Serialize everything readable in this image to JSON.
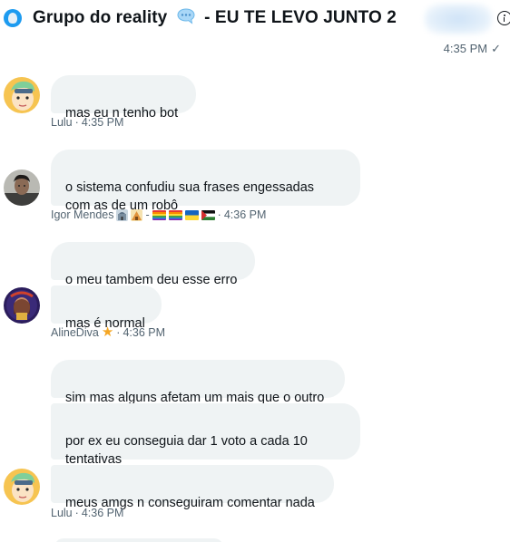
{
  "header": {
    "title_prefix": "Grupo do reality",
    "title_suffix": "- EU TE LEVO JUNTO 2",
    "group_icon": "water-drop-avatar",
    "speech_icon": "speech-bubble-icon",
    "info_icon": "info-icon"
  },
  "top_status": {
    "time": "4:35 PM",
    "check": "✓"
  },
  "messages": [
    {
      "text": "mas eu n tenho bot"
    },
    {
      "text": "o sistema confudiu sua frases engessadas\ncom as de um robô"
    },
    {
      "text": "o meu tambem deu esse erro"
    },
    {
      "text": "mas é normal"
    },
    {
      "text": "sim mas alguns afetam um mais que o outro"
    },
    {
      "text": "por ex eu conseguia dar 1 voto a cada 10\ntentativas"
    },
    {
      "text": "meus amgs n conseguiram comentar nada"
    }
  ],
  "meta": [
    {
      "name": "Lulu",
      "time": "4:35 PM"
    },
    {
      "name": "Igor Mendes",
      "time": "4:36 PM",
      "separator": "-"
    },
    {
      "name": "AlineDiva",
      "time": "4:36 PM"
    },
    {
      "name": "Lulu",
      "time": "4:36 PM"
    }
  ],
  "dot": "·",
  "colors": {
    "bubble": "#eff3f4",
    "text": "#0f1419",
    "muted": "#536471",
    "accent": "#1d9bf0",
    "star": "#f5a623"
  }
}
